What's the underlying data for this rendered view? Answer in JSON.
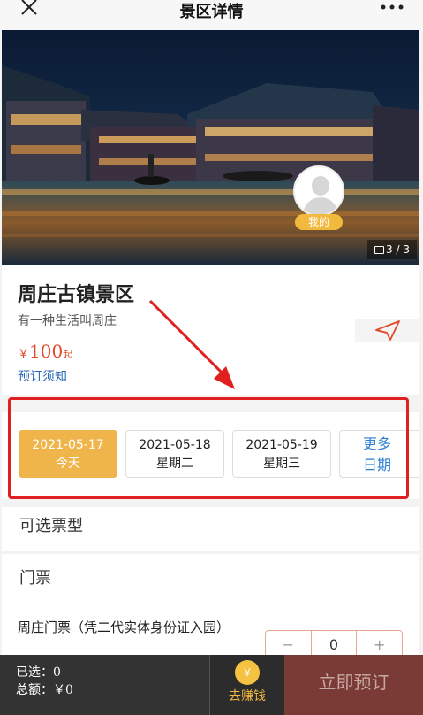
{
  "nav": {
    "title": "景区详情"
  },
  "gallery": {
    "mine_label": "我的",
    "count": "3 / 3"
  },
  "scenic": {
    "name": "周庄古镇景区",
    "slogan": "有一种生活叫周庄",
    "price_currency": "￥",
    "price_value": "100",
    "price_suffix": "起",
    "notice_link": "预订须知"
  },
  "dates": [
    {
      "date": "2021-05-17",
      "day": "今天",
      "active": true
    },
    {
      "date": "2021-05-18",
      "day": "星期二",
      "active": false
    },
    {
      "date": "2021-05-19",
      "day": "星期三",
      "active": false
    }
  ],
  "more_dates": {
    "line1": "更多",
    "line2": "日期"
  },
  "ticket_types_heading": "可选票型",
  "ticket_group_heading": "门票",
  "ticket": {
    "name": "周庄门票（凭二代实体身份证入园）",
    "minus": "−",
    "quantity": "0",
    "plus": "+"
  },
  "bottom": {
    "selected_label": "已选：",
    "selected_value": "0",
    "total_label": "总额：",
    "total_value": "￥0",
    "earn_label": "去赚钱",
    "coin_symbol": "￥",
    "book_label": "立即预订"
  },
  "colors": {
    "accent": "#f0b54a",
    "price": "#e04b2a",
    "link": "#2a67b6",
    "highlight": "#e02020",
    "book_bg": "#7a3b36"
  }
}
